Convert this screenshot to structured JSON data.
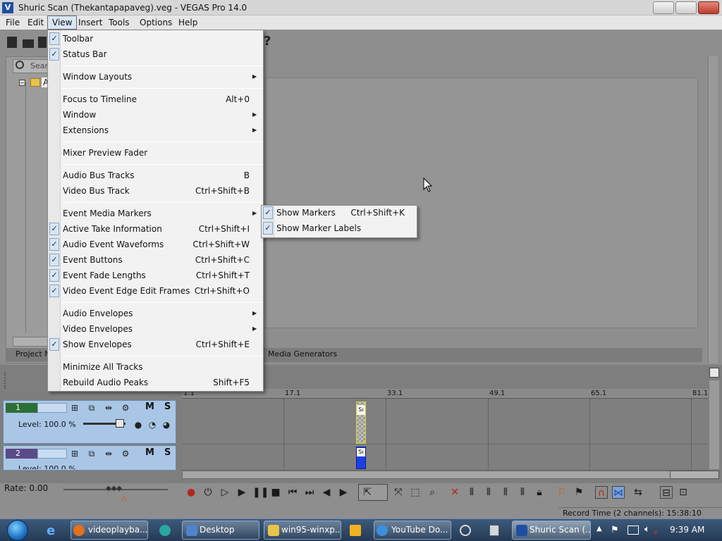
{
  "window": {
    "title": "Shuric Scan (Thekantapapaveg).veg - VEGAS Pro 14.0",
    "app_icon": "V"
  },
  "menubar": [
    {
      "label": "File"
    },
    {
      "label": "Edit"
    },
    {
      "label": "View"
    },
    {
      "label": "Insert"
    },
    {
      "label": "Tools"
    },
    {
      "label": "Options"
    },
    {
      "label": "Help"
    }
  ],
  "view_menu": {
    "items": [
      {
        "label": "Toolbar",
        "shortcut": "",
        "checked": true,
        "submenu": false
      },
      {
        "label": "Status Bar",
        "shortcut": "",
        "checked": true,
        "submenu": false
      },
      {
        "label": "Window Layouts",
        "shortcut": "",
        "checked": false,
        "submenu": true
      },
      {
        "label": "Focus to Timeline",
        "shortcut": "Alt+0",
        "checked": false,
        "submenu": false
      },
      {
        "label": "Window",
        "shortcut": "",
        "checked": false,
        "submenu": true
      },
      {
        "label": "Extensions",
        "shortcut": "",
        "checked": false,
        "submenu": true
      },
      {
        "label": "Mixer Preview Fader",
        "shortcut": "",
        "checked": false,
        "submenu": false
      },
      {
        "label": "Audio Bus Tracks",
        "shortcut": "B",
        "checked": false,
        "submenu": false
      },
      {
        "label": "Video Bus Track",
        "shortcut": "Ctrl+Shift+B",
        "checked": false,
        "submenu": false
      },
      {
        "label": "Event Media Markers",
        "shortcut": "",
        "checked": false,
        "submenu": true
      },
      {
        "label": "Active Take Information",
        "shortcut": "Ctrl+Shift+I",
        "checked": true,
        "submenu": false
      },
      {
        "label": "Audio Event Waveforms",
        "shortcut": "Ctrl+Shift+W",
        "checked": true,
        "submenu": false
      },
      {
        "label": "Event Buttons",
        "shortcut": "Ctrl+Shift+C",
        "checked": true,
        "submenu": false
      },
      {
        "label": "Event Fade Lengths",
        "shortcut": "Ctrl+Shift+T",
        "checked": true,
        "submenu": false
      },
      {
        "label": "Video Event Edge Edit Frames",
        "shortcut": "Ctrl+Shift+O",
        "checked": true,
        "submenu": false
      },
      {
        "label": "Audio Envelopes",
        "shortcut": "",
        "checked": false,
        "submenu": true
      },
      {
        "label": "Video Envelopes",
        "shortcut": "",
        "checked": false,
        "submenu": true
      },
      {
        "label": "Show Envelopes",
        "shortcut": "Ctrl+Shift+E",
        "checked": true,
        "submenu": false
      },
      {
        "label": "Minimize All Tracks",
        "shortcut": "",
        "checked": false,
        "submenu": false
      },
      {
        "label": "Rebuild Audio Peaks",
        "shortcut": "Shift+F5",
        "checked": false,
        "submenu": false
      }
    ],
    "check_glyph": "✓",
    "arrow_glyph": "▶"
  },
  "markers_submenu": {
    "items": [
      {
        "label": "Show Markers",
        "shortcut": "Ctrl+Shift+K",
        "checked": true
      },
      {
        "label": "Show Marker Labels",
        "shortcut": "",
        "checked": true
      }
    ]
  },
  "explorer": {
    "search_placeholder": "Sear",
    "root_label": "A"
  },
  "lower_tabs": {
    "project_media": "Project M",
    "media_generators": "Media Generators"
  },
  "timeline": {
    "ruler_labels": [
      "1.1",
      "17.1",
      "33.1",
      "49.1",
      "65.1",
      "81.1"
    ],
    "tracks": [
      {
        "number": "1",
        "level": "Level: 100.0 %",
        "mute": "M",
        "solo": "S"
      },
      {
        "number": "2",
        "level": "Level: 100.0 %",
        "mute": "M",
        "solo": "S"
      }
    ],
    "clip_label": "Sı"
  },
  "transport": {
    "rate": "Rate: 0.00",
    "record_time": "Record Time (2 channels): 15:38:10"
  },
  "taskbar": {
    "buttons": [
      {
        "label": "videoplayba..."
      },
      {
        "label": "Desktop"
      },
      {
        "label": "win95-winxp..."
      },
      {
        "label": "YouTube Do..."
      },
      {
        "label": "Shuric Scan (..."
      }
    ],
    "time": "9:39 AM"
  },
  "colors": {
    "track_header": "#a9c6e6",
    "audio_clip": "#1d3fe8",
    "video_clip_border": "#d9d91e"
  }
}
